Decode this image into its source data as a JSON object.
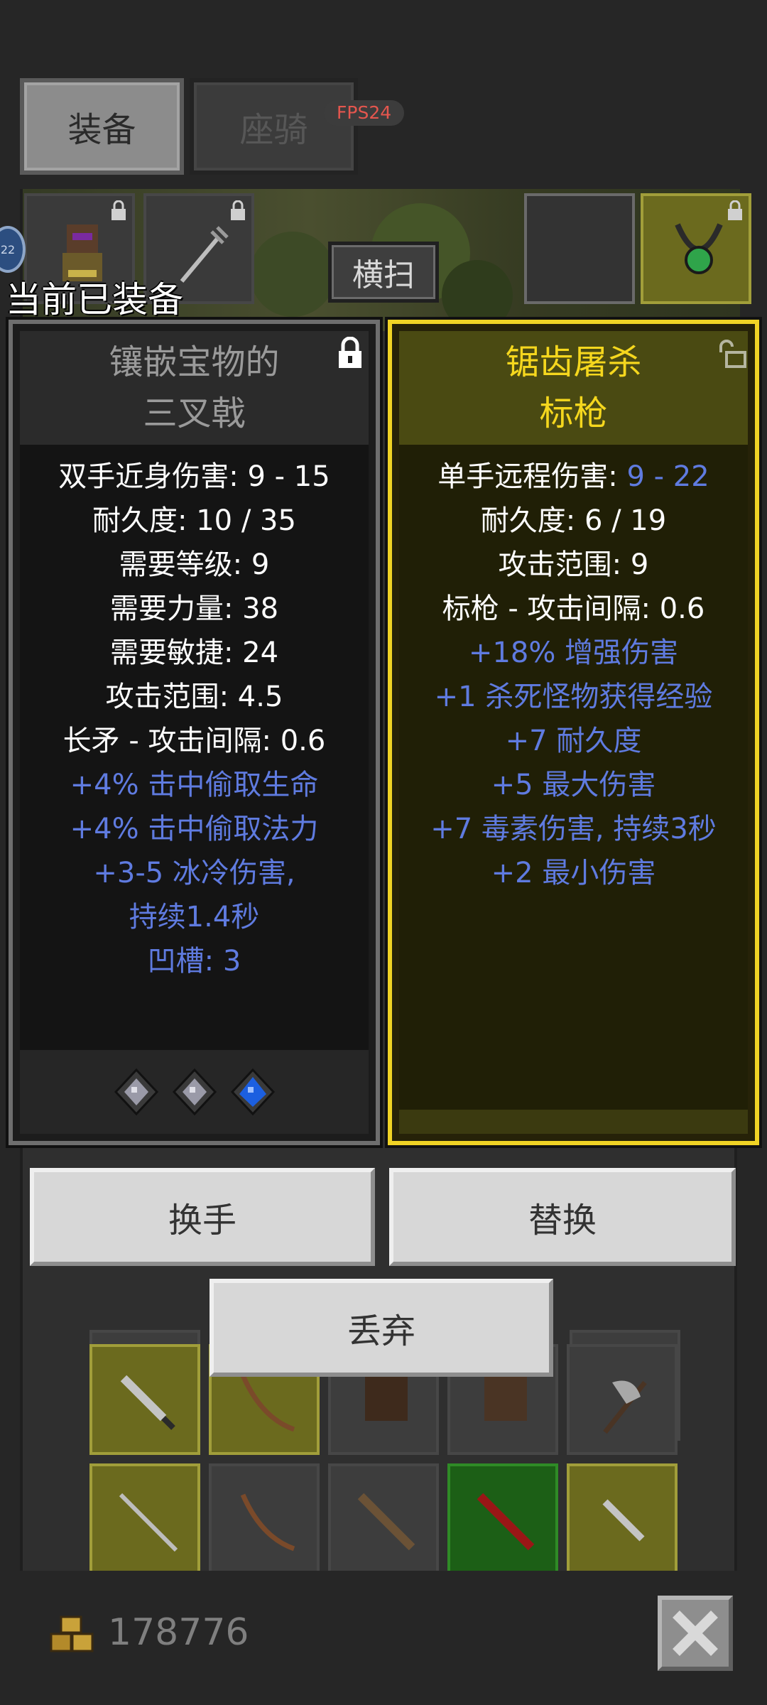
{
  "tabs": [
    {
      "label": "装备",
      "active": true
    },
    {
      "label": "座骑",
      "active": false
    }
  ],
  "fps": "FPS24",
  "skill_button": "横扫",
  "badge_text": "22",
  "equipped_label": "当前已装备",
  "current_item": {
    "name_line1": "镶嵌宝物的",
    "name_line2": "三叉戟",
    "stats": [
      "双手近身伤害: 9 - 15",
      "耐久度: 10 / 35",
      "需要等级: 9",
      "需要力量: 38",
      "需要敏捷: 24",
      "攻击范围: 4.5",
      "长矛 - 攻击间隔: 0.6"
    ],
    "bonuses": [
      "+4% 击中偷取生命",
      "+4% 击中偷取法力",
      "+3-5 冰冷伤害,",
      "持续1.4秒",
      "凹槽: 3"
    ],
    "gems": [
      "gray-gem-icon",
      "gray-gem-icon",
      "blue-gem-icon"
    ],
    "locked": true
  },
  "new_item": {
    "name_line1": "锯齿屠杀",
    "name_line2": "标枪",
    "damage_label": "单手远程伤害: ",
    "damage_value": "9 - 22",
    "stats": [
      "耐久度: 6 / 19",
      "攻击范围: 9",
      "标枪 - 攻击间隔: 0.6"
    ],
    "bonuses": [
      "+18% 增强伤害",
      "+1 杀死怪物获得经验",
      "+7 耐久度",
      "+5 最大伤害",
      "+7 毒素伤害, 持续3秒",
      "+2 最小伤害"
    ],
    "locked": false
  },
  "actions": {
    "swap_hands": "换手",
    "replace": "替换",
    "discard": "丢弃"
  },
  "gold": "178776",
  "colors": {
    "rare_yellow": "#f5d71e",
    "magic_blue": "#5f7be0",
    "fps_red": "#e5564e"
  }
}
